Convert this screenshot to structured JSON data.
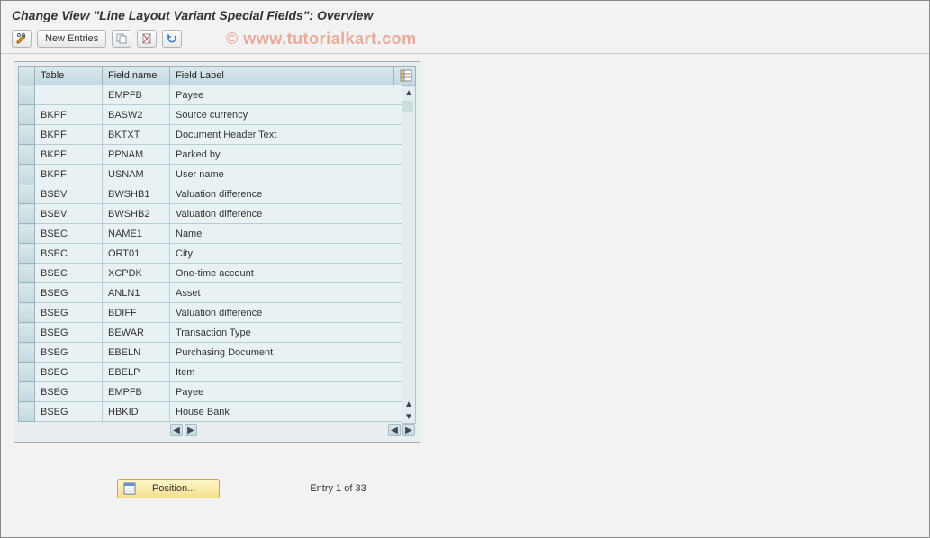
{
  "title": "Change View \"Line Layout Variant Special Fields\": Overview",
  "watermark": "© www.tutorialkart.com",
  "toolbar": {
    "new_entries": "New Entries"
  },
  "columns": {
    "table": "Table",
    "field_name": "Field name",
    "field_label": "Field Label"
  },
  "rows": [
    {
      "table": "",
      "field": "EMPFB",
      "label": "Payee"
    },
    {
      "table": "BKPF",
      "field": "BASW2",
      "label": "Source currency"
    },
    {
      "table": "BKPF",
      "field": "BKTXT",
      "label": "Document Header Text"
    },
    {
      "table": "BKPF",
      "field": "PPNAM",
      "label": "Parked by"
    },
    {
      "table": "BKPF",
      "field": "USNAM",
      "label": "User name"
    },
    {
      "table": "BSBV",
      "field": "BWSHB1",
      "label": "Valuation difference"
    },
    {
      "table": "BSBV",
      "field": "BWSHB2",
      "label": "Valuation difference"
    },
    {
      "table": "BSEC",
      "field": "NAME1",
      "label": "Name"
    },
    {
      "table": "BSEC",
      "field": "ORT01",
      "label": "City"
    },
    {
      "table": "BSEC",
      "field": "XCPDK",
      "label": "One-time account"
    },
    {
      "table": "BSEG",
      "field": "ANLN1",
      "label": "Asset"
    },
    {
      "table": "BSEG",
      "field": "BDIFF",
      "label": "Valuation difference"
    },
    {
      "table": "BSEG",
      "field": "BEWAR",
      "label": "Transaction Type"
    },
    {
      "table": "BSEG",
      "field": "EBELN",
      "label": "Purchasing Document"
    },
    {
      "table": "BSEG",
      "field": "EBELP",
      "label": "Item"
    },
    {
      "table": "BSEG",
      "field": "EMPFB",
      "label": "Payee"
    },
    {
      "table": "BSEG",
      "field": "HBKID",
      "label": "House Bank"
    }
  ],
  "position_button": "Position...",
  "entry_status": "Entry 1 of 33"
}
